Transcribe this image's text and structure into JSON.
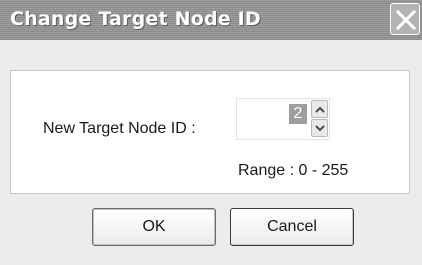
{
  "window": {
    "title": "Change Target Node ID"
  },
  "form": {
    "id_label": "New Target Node ID :",
    "spinner_value": "2",
    "range_label": "Range : 0 - 255"
  },
  "buttons": {
    "ok": "OK",
    "cancel": "Cancel"
  },
  "colors": {
    "titlebar": "#949494",
    "dialog_bg": "#ececec",
    "group_bg": "#ffffff",
    "selection": "#9e9e9e"
  },
  "icons": {
    "close": "close-icon",
    "spin_up": "chevron-up-icon",
    "spin_down": "chevron-down-icon"
  }
}
